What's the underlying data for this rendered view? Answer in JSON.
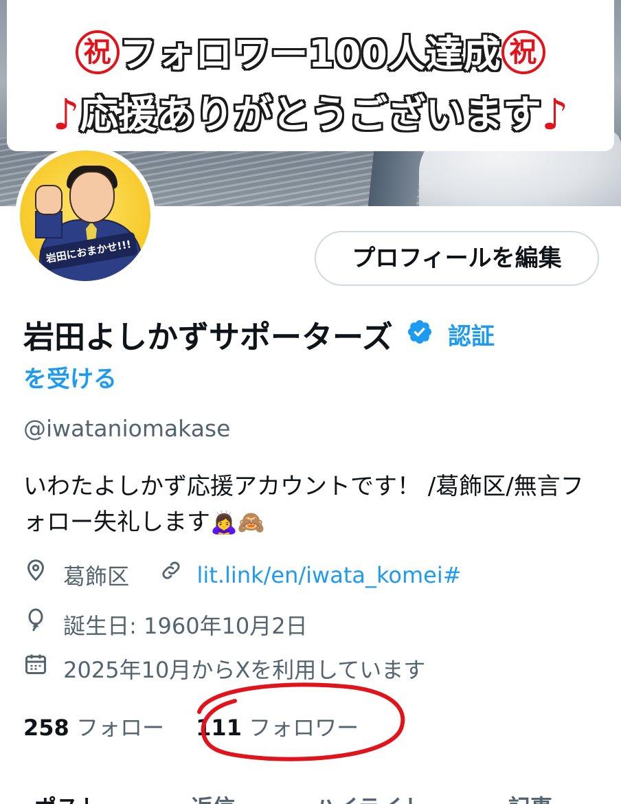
{
  "banner": {
    "iwai_char": "祝",
    "line1": "フォロワー100人達成",
    "note_char": "♪",
    "line2": "応援ありがとうございます"
  },
  "avatar": {
    "caption": "岩田におまかせ!!!"
  },
  "profile": {
    "edit_button": "プロフィールを編集",
    "display_name": "岩田よしかずサポーターズ",
    "verify_cta_1": "認証",
    "verify_cta_2": "を受ける",
    "handle": "@iwataniomakase",
    "bio_text": "いわたよしかず応援アカウントです！ /葛飾区/無言フォロー失礼します",
    "bio_emoji": "🙇‍♀️🙈",
    "location": "葛飾区",
    "website": "lit.link/en/iwata_komei#",
    "birthday": "誕生日: 1960年10月2日",
    "joined": "2025年10月からXを利用しています",
    "following_count": "258",
    "following_label": "フォロー",
    "followers_count": "111",
    "followers_label": "フォロワー"
  },
  "tabs": [
    {
      "label": "ポスト"
    },
    {
      "label": "返信"
    },
    {
      "label": "ハイライト"
    },
    {
      "label": "記事"
    }
  ],
  "colors": {
    "accent": "#1d9bf0",
    "annotation_circle": "#e1141c"
  }
}
